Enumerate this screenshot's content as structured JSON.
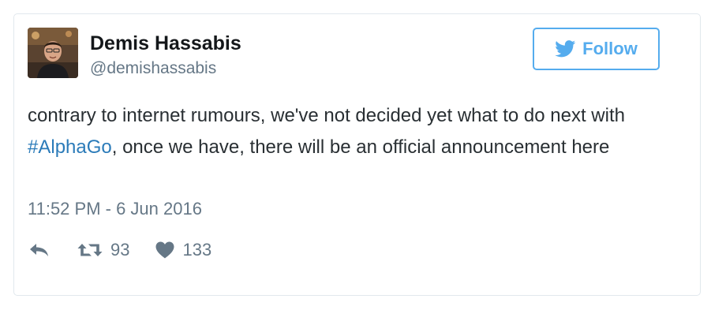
{
  "author": {
    "name": "Demis Hassabis",
    "handle": "@demishassabis"
  },
  "follow_button": {
    "label": "Follow"
  },
  "tweet": {
    "text_before": "contrary to internet rumours, we've not decided yet what to do next with ",
    "hashtag": "#AlphaGo",
    "text_after": ", once we have, there will be an official announcement here",
    "timestamp": "11:52 PM - 6 Jun 2016"
  },
  "stats": {
    "retweets": "93",
    "likes": "133"
  },
  "colors": {
    "accent": "#55acee",
    "link": "#2b7bb9",
    "muted": "#657786",
    "text": "#292f33",
    "border": "#e1e8ed"
  },
  "icons": {
    "follow": "twitter-bird-icon",
    "reply": "reply-icon",
    "retweet": "retweet-icon",
    "like": "heart-icon"
  }
}
